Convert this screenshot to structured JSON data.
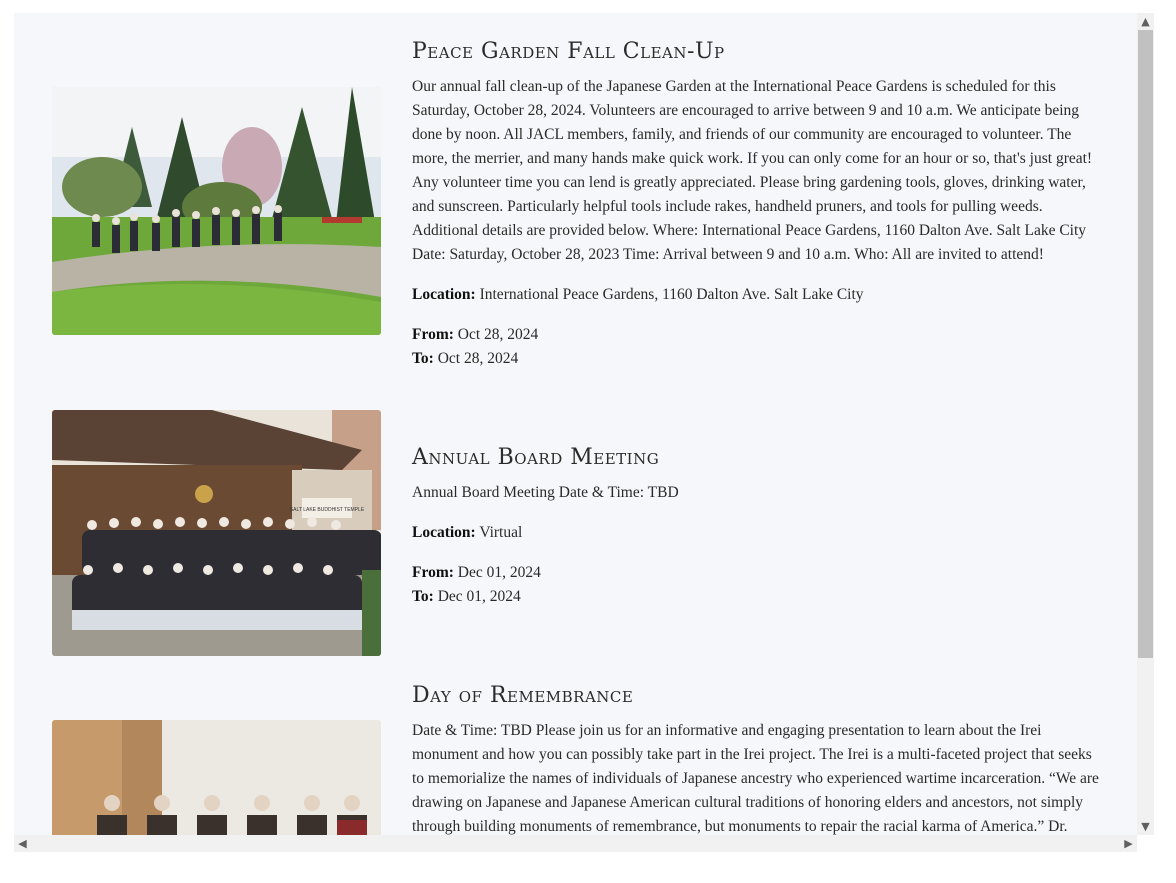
{
  "events": [
    {
      "title": "Peace Garden Fall Clean-Up",
      "description": "Our annual fall clean-up of the Japanese Garden at the International Peace Gardens is scheduled for this Saturday, October 28, 2024. Volunteers are encouraged to arrive between 9 and 10 a.m. We anticipate being done by noon. All JACL members, family, and friends of our community are encouraged to volunteer. The more, the merrier, and many hands make quick work. If you can only come for an hour or so, that's just great! Any volunteer time you can lend is greatly appreciated. Please bring gardening tools, gloves, drinking water, and sunscreen. Particularly helpful tools include rakes, handheld pruners, and tools for pulling weeds. Additional details are provided below. Where: International Peace Gardens, 1160 Dalton Ave. Salt Lake City Date: Saturday, October 28, 2023 Time: Arrival between 9 and 10 a.m. Who: All are invited to attend!",
      "location_label": "Location:",
      "location": "International Peace Gardens, 1160 Dalton Ave. Salt Lake City",
      "from_label": "From:",
      "from": "Oct 28, 2024",
      "to_label": "To:",
      "to": "Oct 28, 2024"
    },
    {
      "title": "Annual Board Meeting",
      "description": "Annual Board Meeting Date & Time: TBD",
      "location_label": "Location:",
      "location": "Virtual",
      "from_label": "From:",
      "from": "Dec 01, 2024",
      "to_label": "To:",
      "to": "Dec 01, 2024"
    },
    {
      "title": "Day of Remembrance",
      "description": "Date & Time: TBD Please join us for an informative and engaging presentation to learn about the Irei monument and how you can possibly take part in the Irei project. The Irei is a multi-faceted project that seeks to memorialize the names of individuals of Japanese ancestry who experienced wartime incarceration. “We are drawing on Japanese and Japanese American cultural traditions of honoring elders and ancestors, not simply through building monuments of remembrance, but monuments to repair the racial karma of America.” Dr."
    }
  ],
  "images": {
    "event1": "garden-volunteers-group-photo",
    "event2": "buddhist-temple-group-photo",
    "event3": "panel-presentation-photo",
    "temple_sign": "SALT LAKE BUDDHIST TEMPLE"
  },
  "scrollbar": {
    "up_icon": "▲",
    "down_icon": "▼",
    "left_icon": "◀",
    "right_icon": "▶"
  },
  "colors": {
    "background": "#f5f7fa",
    "text": "#2a2a2a"
  }
}
